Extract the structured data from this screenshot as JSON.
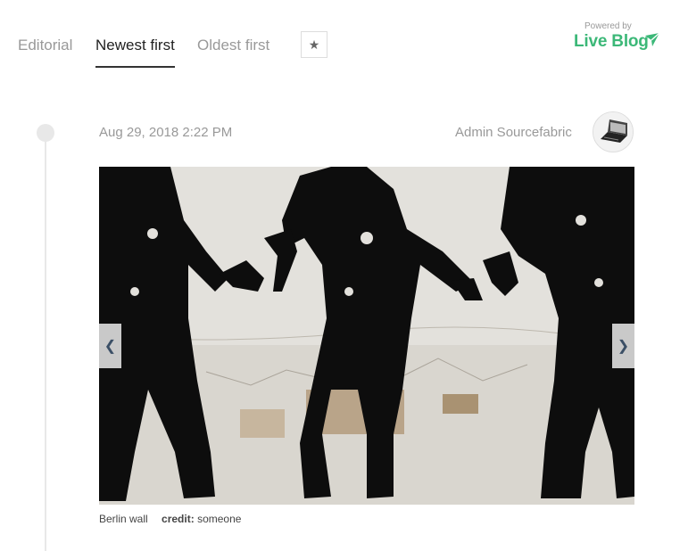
{
  "tabs": [
    {
      "label": "Editorial",
      "active": false
    },
    {
      "label": "Newest first",
      "active": true
    },
    {
      "label": "Oldest first",
      "active": false
    }
  ],
  "highlights_icon": "star-icon",
  "branding": {
    "powered_by": "Powered by",
    "name": "Live Blog",
    "accent_color": "#3cb878"
  },
  "post": {
    "date": "Aug 29, 2018 2:22 PM",
    "author": "Admin Sourcefabric",
    "image": {
      "caption": "Berlin wall",
      "credit_label": "credit:",
      "credit_value": "someone"
    },
    "nav": {
      "prev_icon": "chevron-left-icon",
      "next_icon": "chevron-right-icon"
    }
  }
}
